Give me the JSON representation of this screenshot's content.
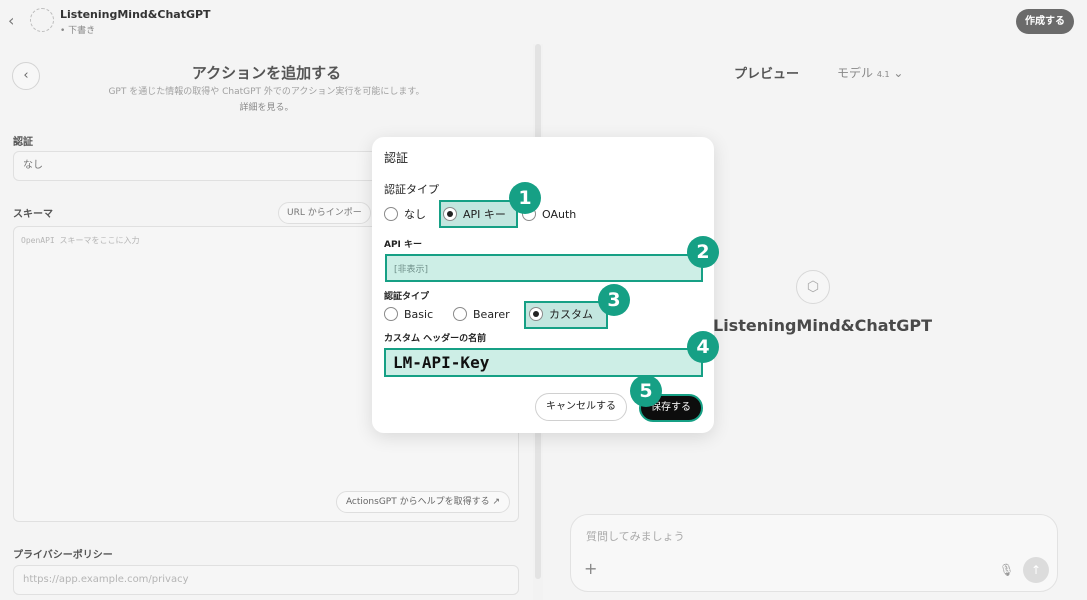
{
  "topbar": {
    "gpt_name": "ListeningMind&ChatGPT",
    "status": "• 下書き",
    "create_label": "作成する"
  },
  "left": {
    "title": "アクションを追加する",
    "description": "GPT を通じた情報の取得や ChatGPT 外でのアクション実行を可能にします。",
    "learn_more": "詳細を見る。",
    "auth_label": "認証",
    "auth_value": "なし",
    "schema_label": "スキーマ",
    "import_label": "URL からインポー",
    "schema_placeholder": "OpenAPI スキーマをここに入力",
    "help_label": "ActionsGPT からヘルプを取得する",
    "privacy_label": "プライバシーポリシー",
    "privacy_placeholder": "https://app.example.com/privacy"
  },
  "right": {
    "preview_label": "プレビュー",
    "model_label": "モデル",
    "model_version": "4.1",
    "preview_name": "ListeningMind&ChatGPT",
    "chat_placeholder": "質問してみましょう"
  },
  "modal": {
    "title": "認証",
    "auth_type_label": "認証タイプ",
    "auth_options": [
      {
        "label": "なし",
        "selected": false
      },
      {
        "label": "API キー",
        "selected": true
      },
      {
        "label": "OAuth",
        "selected": false
      }
    ],
    "api_key_label": "API キー",
    "api_key_value": "[非表示]",
    "auth_type2_label": "認証タイプ",
    "auth_type2_options": [
      {
        "label": "Basic",
        "selected": false
      },
      {
        "label": "Bearer",
        "selected": false
      },
      {
        "label": "カスタム",
        "selected": true
      }
    ],
    "header_name_label": "カスタム ヘッダーの名前",
    "header_name_value": "LM-API-Key",
    "cancel_label": "キャンセルする",
    "save_label": "保存する"
  },
  "annotations": {
    "color": "#16a085",
    "badges": [
      "1",
      "2",
      "3",
      "4",
      "5"
    ]
  },
  "icons": [
    "chevron-left-icon",
    "gpt-placeholder-icon",
    "cube-icon",
    "plus-icon",
    "mic-icon",
    "send-arrow-icon",
    "external-link-icon",
    "chevron-down-icon"
  ]
}
